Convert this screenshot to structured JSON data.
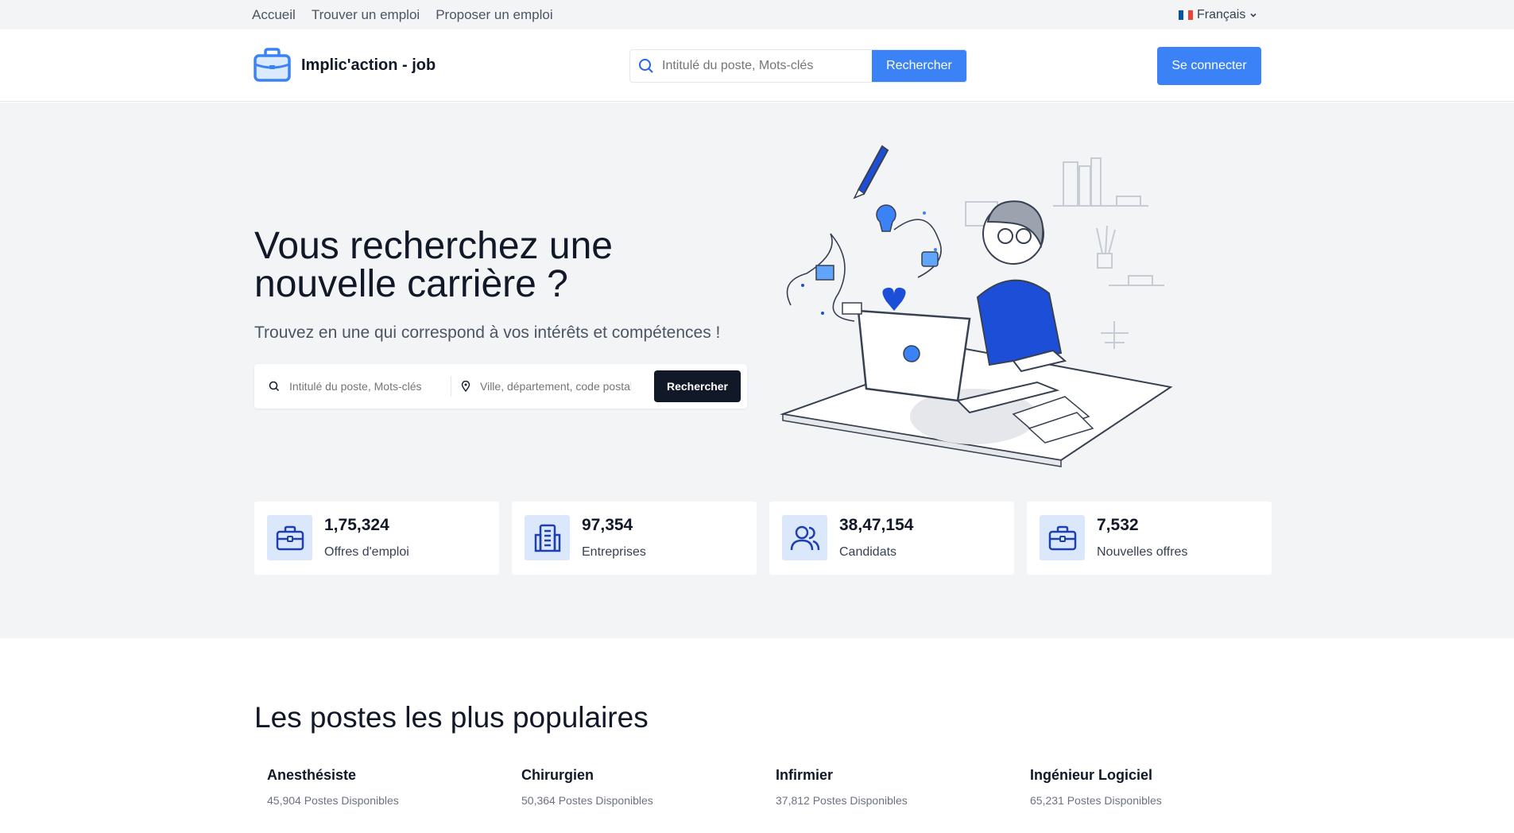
{
  "topnav": {
    "items": [
      "Accueil",
      "Trouver un emploi",
      "Proposer un emploi"
    ]
  },
  "language": {
    "label": "Français",
    "flag_colors": [
      "#0055a4",
      "#ffffff",
      "#ef4135"
    ]
  },
  "header": {
    "logo_text": "Implic'action - job",
    "search_placeholder": "Intitulé du poste, Mots-clés",
    "search_button": "Rechercher",
    "login_button": "Se connecter"
  },
  "hero": {
    "title": "Vous recherchez une nouvelle carrière ?",
    "subtitle": "Trouvez en une qui correspond à vos intérêts et compétences !",
    "keyword_placeholder": "Intitulé du poste, Mots-clés",
    "location_placeholder": "Ville, département, code postal",
    "search_button": "Rechercher"
  },
  "stats": [
    {
      "value": "1,75,324",
      "label": "Offres d'emploi",
      "icon": "briefcase-icon"
    },
    {
      "value": "97,354",
      "label": "Entreprises",
      "icon": "building-icon"
    },
    {
      "value": "38,47,154",
      "label": "Candidats",
      "icon": "users-icon"
    },
    {
      "value": "7,532",
      "label": "Nouvelles offres",
      "icon": "briefcase-icon"
    }
  ],
  "popular": {
    "title": "Les postes les plus populaires",
    "jobs": [
      {
        "name": "Anesthésiste",
        "count": "45,904 Postes Disponibles"
      },
      {
        "name": "Chirurgien",
        "count": "50,364 Postes Disponibles"
      },
      {
        "name": "Infirmier",
        "count": "37,812 Postes Disponibles"
      },
      {
        "name": "Ingénieur Logiciel",
        "count": "65,231 Postes Disponibles"
      }
    ]
  },
  "colors": {
    "accent": "#3b82f6",
    "dark": "#111827",
    "icon_blue": "#1e40af",
    "icon_bg": "#dbe7fb",
    "hero_bg": "#f3f4f6"
  }
}
